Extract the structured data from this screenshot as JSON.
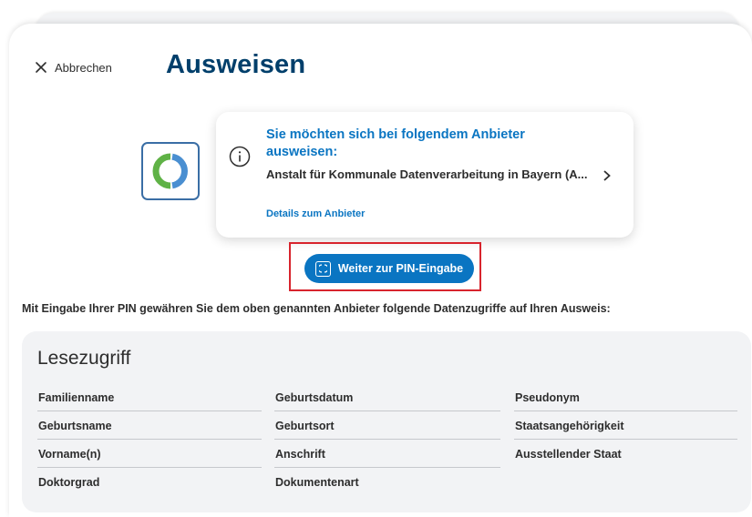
{
  "header": {
    "cancel_label": "Abbrechen",
    "title": "Ausweisen"
  },
  "provider": {
    "heading": "Sie möchten sich bei folgendem Anbieter ausweisen:",
    "name": "Anstalt für Kommunale Datenverarbeitung in Bayern (A...",
    "details_link": "Details zum Anbieter"
  },
  "action": {
    "pin_button": "Weiter zur PIN-Eingabe"
  },
  "notice": "Mit Eingabe Ihrer PIN gewähren Sie dem oben genannten Anbieter folgende Datenzugriffe auf Ihren Ausweis:",
  "read_access": {
    "title": "Lesezugriff",
    "columns": [
      [
        "Familienname",
        "Geburtsname",
        "Vorname(n)",
        "Doktorgrad"
      ],
      [
        "Geburtsdatum",
        "Geburtsort",
        "Anschrift",
        "Dokumentenart"
      ],
      [
        "Pseudonym",
        "Staatsangehörigkeit",
        "Ausstellender Staat"
      ]
    ]
  },
  "colors": {
    "title": "#003f6b",
    "accent": "#0a75c2",
    "highlight": "#d8242d",
    "panel": "#f2f3f5"
  },
  "icons": [
    "close-icon",
    "app-logo",
    "info-icon",
    "chevron-right-icon",
    "id-card-icon"
  ]
}
